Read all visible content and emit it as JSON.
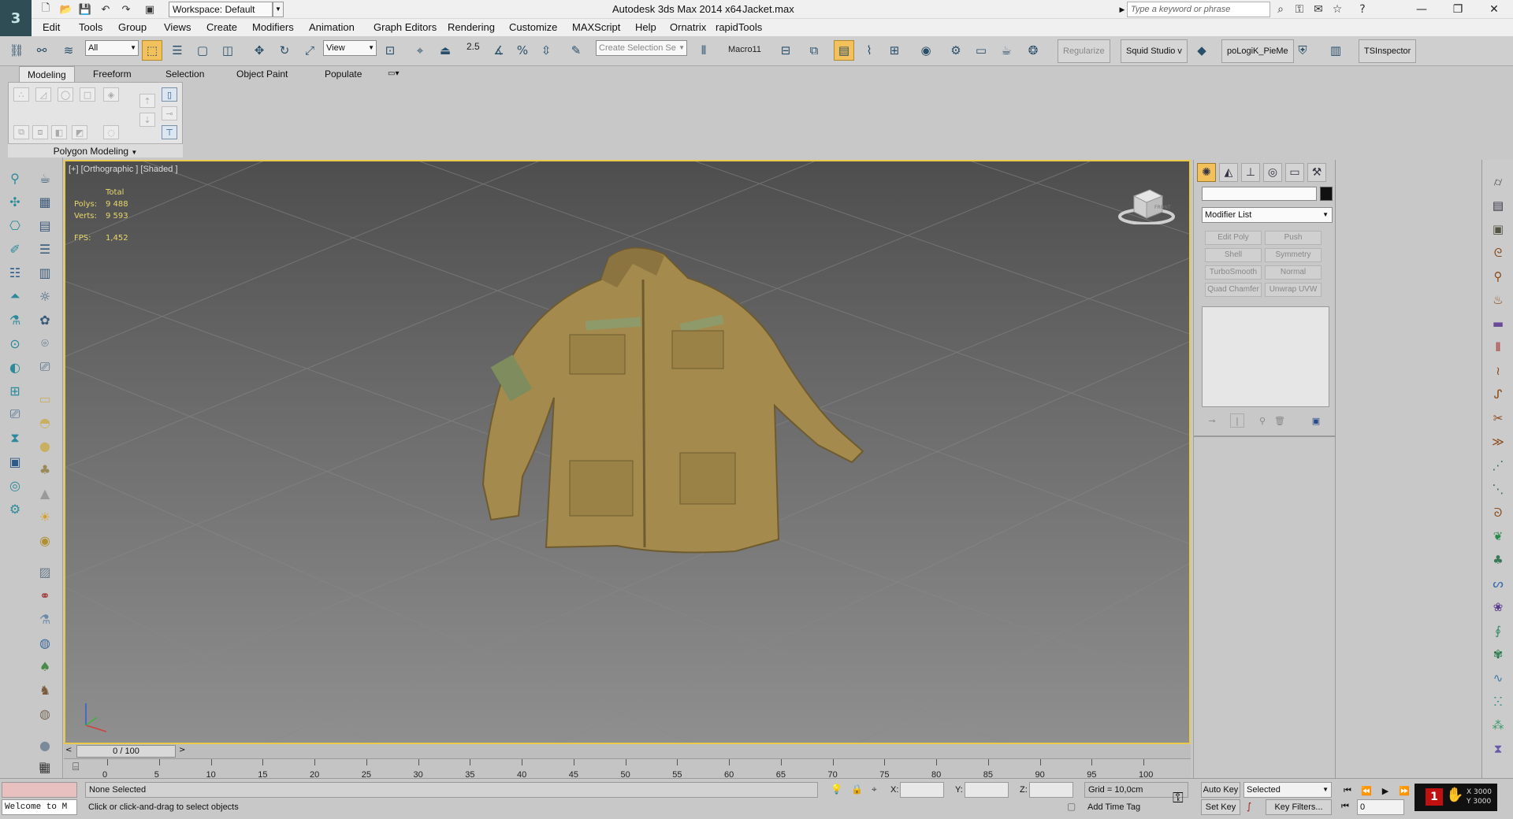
{
  "titlebar": {
    "workspace": "Workspace: Default",
    "app": "Autodesk 3ds Max  2014 x64",
    "file": "Jacket.max",
    "search_placeholder": "Type a keyword or phrase",
    "logo": "3"
  },
  "menu": [
    "Edit",
    "Tools",
    "Group",
    "Views",
    "Create",
    "Modifiers",
    "Animation",
    "Graph Editors",
    "Rendering",
    "Customize",
    "MAXScript",
    "Help",
    "Ornatrix",
    "rapidTools"
  ],
  "toolbar": {
    "filter": "All",
    "refcoord": "View",
    "snap_label": "2.5",
    "selset_placeholder": "Create Selection Se",
    "macro": "Macro11",
    "regularize": "Regularize",
    "squid": "Squid Studio v",
    "topologik": "poLogiK_PieMe",
    "tsinspector": "TSInspector"
  },
  "ribbon": {
    "tabs": [
      "Modeling",
      "Freeform",
      "Selection",
      "Object Paint",
      "Populate"
    ],
    "panel_label": "Polygon Modeling"
  },
  "viewport": {
    "label": "[+] [Orthographic ] [Shaded ]",
    "stats": {
      "total": "Total",
      "polys_label": "Polys:",
      "polys": "9 488",
      "verts_label": "Verts:",
      "verts": "9 593",
      "fps_label": "FPS:",
      "fps": "1,452"
    },
    "viewcube": "FRONT"
  },
  "command_panel": {
    "modifier_list": "Modifier List",
    "buttons": [
      "Edit Poly",
      "Push",
      "Shell",
      "Symmetry",
      "TurboSmooth",
      "Normal",
      "Quad Chamfer",
      "Unwrap UVW"
    ]
  },
  "timeline": {
    "slider": "0 / 100",
    "ticks": [
      "0",
      "5",
      "10",
      "15",
      "20",
      "25",
      "30",
      "35",
      "40",
      "45",
      "50",
      "55",
      "60",
      "65",
      "70",
      "75",
      "80",
      "85",
      "90",
      "95",
      "100"
    ]
  },
  "status": {
    "maxscript": "Welcome to M",
    "selection": "None Selected",
    "prompt": "Click or click-and-drag to select objects",
    "x": "X:",
    "y": "Y:",
    "z": "Z:",
    "grid": "Grid = 10,0cm",
    "add_time_tag": "Add Time Tag",
    "auto_key": "Auto Key",
    "set_key": "Set Key",
    "key_mode": "Selected",
    "key_filters": "Key Filters...",
    "frame": "0",
    "overlay_x": "X 3000",
    "overlay_y": "Y 3000"
  }
}
